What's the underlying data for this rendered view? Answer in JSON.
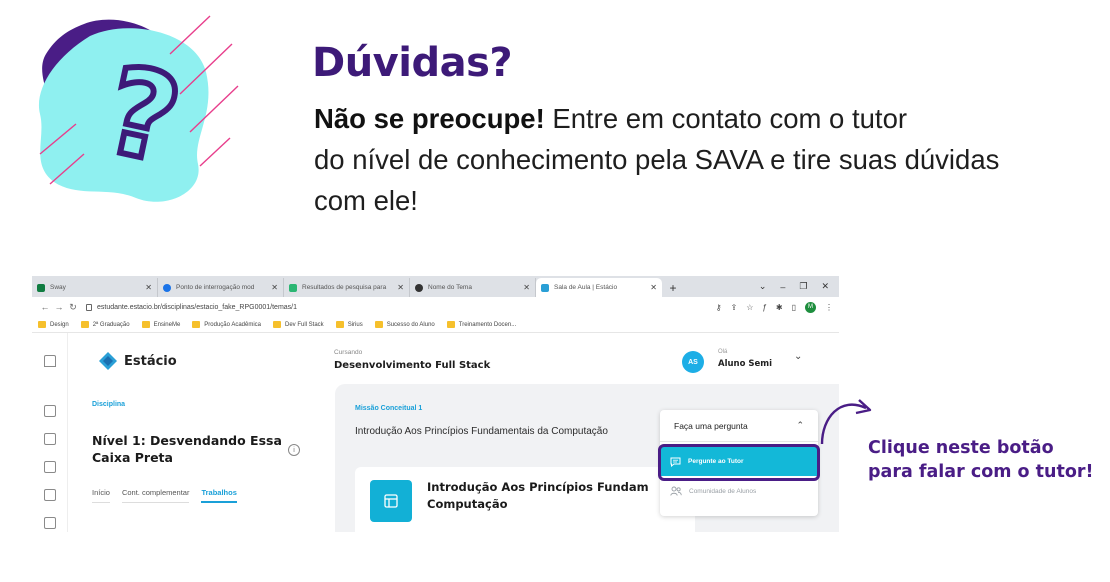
{
  "slide": {
    "title": "Dúvidas?",
    "body_bold": "Não se preocupe!",
    "body_line1": " Entre em contato com o tutor",
    "body_line2": "do nível de conhecimento pela SAVA e tire suas dúvidas",
    "body_line3": "com ele!",
    "callout_line1": "Clique neste botão",
    "callout_line2": "para falar com o tutor!"
  },
  "colors": {
    "title": "#3d1a78",
    "callout": "#4a1d86",
    "accent_cyan": "#13b8d8",
    "blob_cyan": "#8ff0f0"
  },
  "browser": {
    "tabs": [
      {
        "title": "Sway",
        "icon": "sway-icon",
        "color": "#107c41",
        "active": false
      },
      {
        "title": "Ponto de interrogação mod",
        "icon": "search-icon",
        "color": "#1a73e8",
        "active": false
      },
      {
        "title": "Resultados de pesquisa para",
        "icon": "vector-icon",
        "color": "#2bb673",
        "active": false
      },
      {
        "title": "Nome do Tema",
        "icon": "github-icon",
        "color": "#333333",
        "active": false
      },
      {
        "title": "Sala de Aula | Estácio",
        "icon": "estacio-icon",
        "color": "#2a9fd6",
        "active": true
      }
    ],
    "url": "estudante.estacio.br/disciplinas/estacio_fake_RPG0001/temas/1",
    "account_initial": "M",
    "bookmarks": [
      "Design",
      "2ª Graduação",
      "EnsineMe",
      "Produção Acadêmica",
      "Dev Full Stack",
      "Sirius",
      "Sucesso do Aluno",
      "Treinamento Docen..."
    ]
  },
  "app": {
    "brand": "Estácio",
    "course_eyebrow": "Cursando",
    "course_name": "Desenvolvimento Full Stack",
    "user_initials": "AS",
    "user_greeting": "Olá",
    "user_name": "Aluno Semi",
    "discipline_label": "Disciplina",
    "level_title": "Nível 1: Desvendando Essa Caixa Preta",
    "section_tabs": [
      "Início",
      "Cont. complementar",
      "Trabalhos"
    ],
    "active_section_tab": "Trabalhos",
    "mission_label": "Missão Conceitual 1",
    "mission_title": "Introdução Aos Princípios Fundamentais da Computação",
    "mission_card_title_line1": "Introdução Aos Princípios Fundam",
    "mission_card_title_line2": "Computação",
    "ask_toggle": "Faça uma pergunta",
    "ask_tutor": "Pergunte ao Tutor",
    "ask_community": "Comunidade de Alunos"
  }
}
